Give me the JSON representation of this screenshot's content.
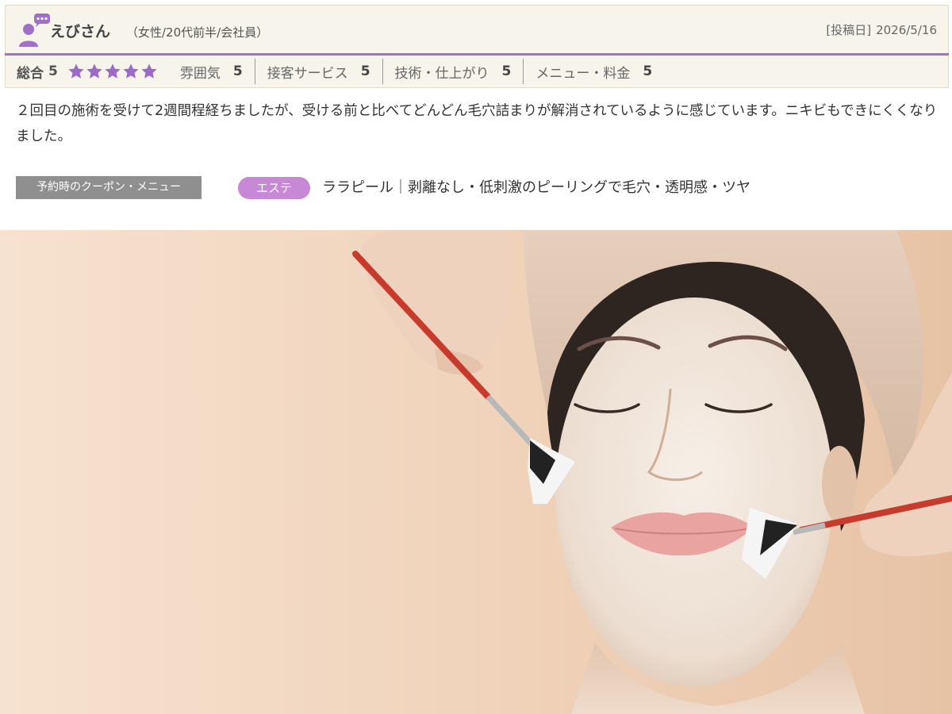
{
  "reviewer": {
    "name": "えびさん",
    "meta": "（女性/20代前半/会社員）",
    "avatar_icon": "user-comment-icon"
  },
  "post": {
    "date_label": "[投稿日]",
    "date": "2026/5/16"
  },
  "ratings": {
    "overall_label": "総合",
    "overall_score": "5",
    "stars": 5,
    "star_color": "#9b6ac9",
    "categories": [
      {
        "name": "雰囲気",
        "score": "5"
      },
      {
        "name": "接客サービス",
        "score": "5"
      },
      {
        "name": "技術・仕上がり",
        "score": "5"
      },
      {
        "name": "メニュー・料金",
        "score": "5"
      }
    ]
  },
  "body": {
    "text": "２回目の施術を受けて2週間程経ちましたが、受ける前と比べてどんどん毛穴詰まりが解消されているように感じています。ニキビもできにくくなりました。"
  },
  "coupon": {
    "label": "予約時のクーポン・メニュー",
    "category": "エステ",
    "category_color": "#c788d6",
    "title": "ララピール｜剥離なし・低刺激のピーリングで毛穴・透明感・ツヤ"
  },
  "colors": {
    "accent": "#a070c8",
    "header_bg": "#f7f4ec"
  }
}
